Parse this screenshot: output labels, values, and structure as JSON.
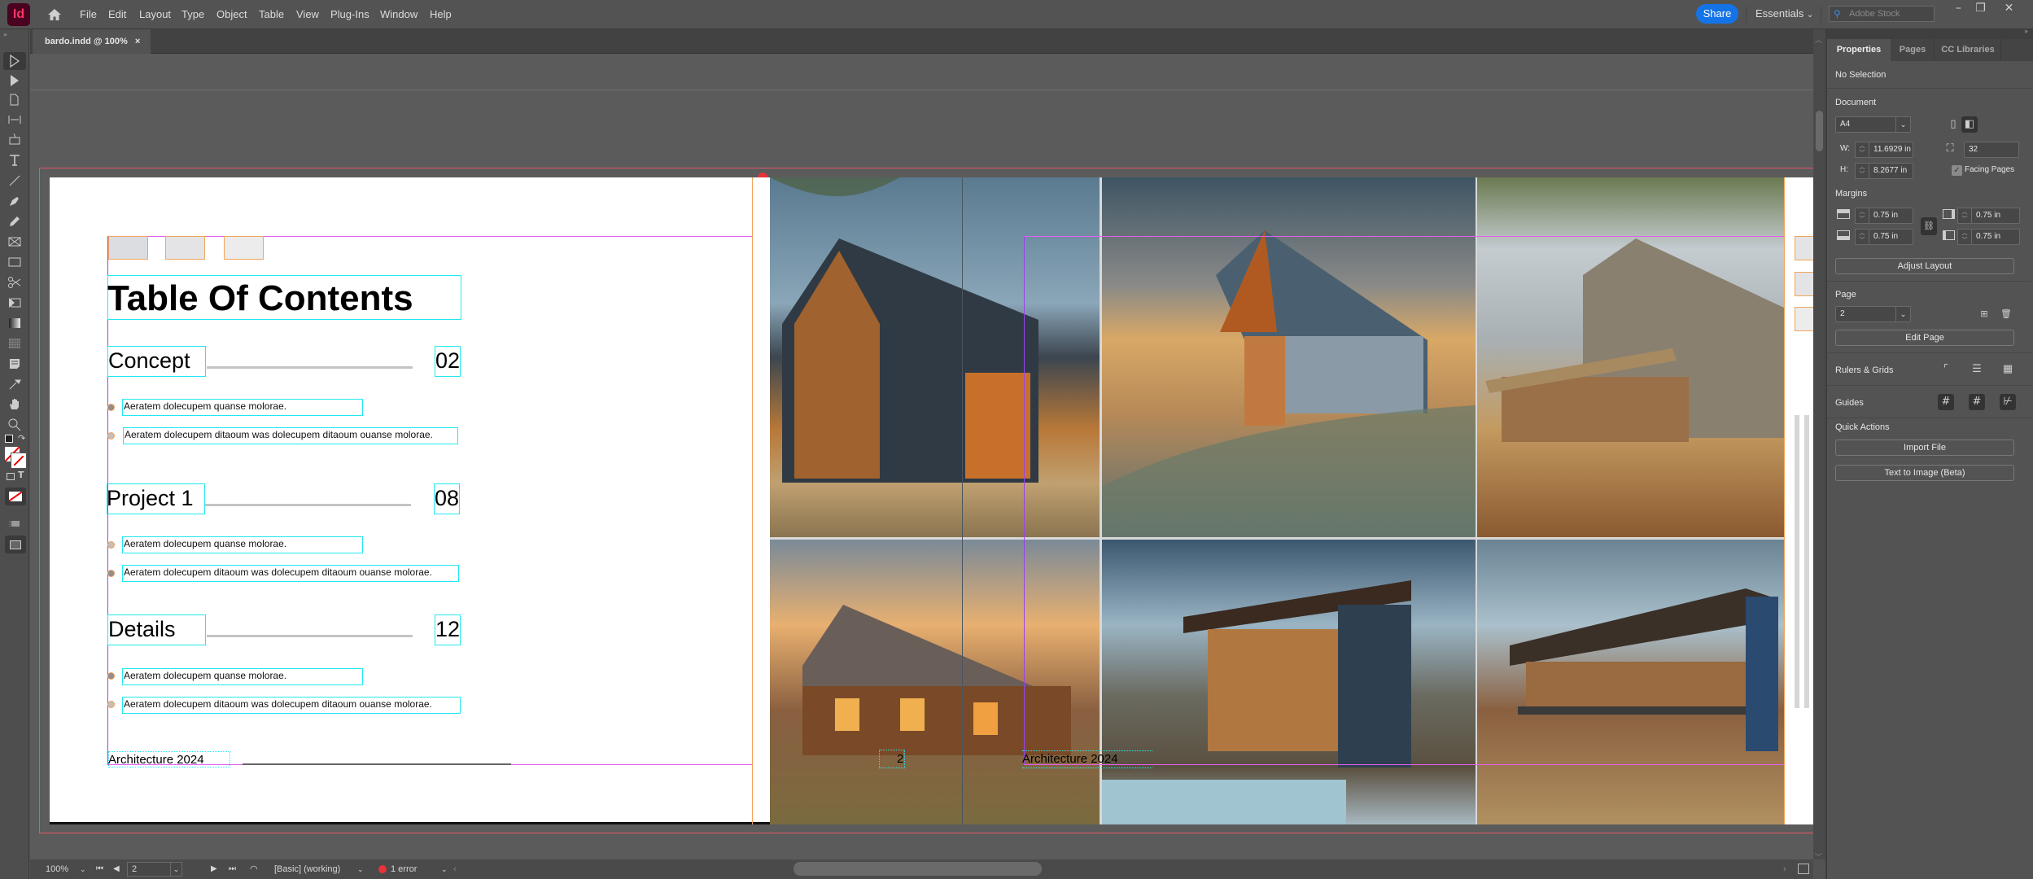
{
  "app": {
    "logo": "Id",
    "brand_color": "#ff3366"
  },
  "menu": [
    "File",
    "Edit",
    "Layout",
    "Type",
    "Object",
    "Table",
    "View",
    "Plug-Ins",
    "Window",
    "Help"
  ],
  "header": {
    "share_label": "Share",
    "workspace_label": "Essentials",
    "search_placeholder": "Adobe Stock",
    "share_color": "#1473e6"
  },
  "document_tab": {
    "label": "bardo.indd @ 100%",
    "close": "×"
  },
  "page": {
    "title": "Table Of Contents",
    "sections": [
      {
        "name": "Concept",
        "page": "02",
        "items": [
          "Aeratem dolecupem quanse molorae.",
          "Aeratem dolecupem ditaoum was dolecupem ditaoum ouanse molorae."
        ]
      },
      {
        "name": "Project 1",
        "page": "08",
        "items": [
          "Aeratem dolecupem quanse molorae.",
          "Aeratem dolecupem ditaoum was dolecupem ditaoum ouanse molorae."
        ]
      },
      {
        "name": "Details",
        "page": "12",
        "items": [
          "Aeratem dolecupem quanse molorae.",
          "Aeratem dolecupem ditaoum was dolecupem ditaoum ouanse molorae."
        ]
      }
    ],
    "footer_left": "Architecture 2024",
    "page_number_left": "2",
    "footer_right": "Architecture 2024",
    "photos": [
      "modern-glass-barn-house",
      "hillside-barn-house-stilts",
      "rustic-two-story-farmhouse",
      "lit-farmhouse-at-dusk",
      "modern-house-with-pool",
      "farmhouse-with-deck"
    ]
  },
  "properties": {
    "tabs": [
      "Properties",
      "Pages",
      "CC Libraries"
    ],
    "selection": "No Selection",
    "document_label": "Document",
    "preset": "A4",
    "width_label": "W:",
    "width": "11.6929 in",
    "height_label": "H:",
    "height": "8.2677 in",
    "pages_count": "32",
    "facing_pages_label": "Facing Pages",
    "facing_pages_checked": true,
    "margins_label": "Margins",
    "margin_top": "0.75 in",
    "margin_bottom": "0.75 in",
    "margin_inside": "0.75 in",
    "margin_outside": "0.75 in",
    "adjust_layout": "Adjust Layout",
    "page_label": "Page",
    "page_value": "2",
    "edit_page": "Edit Page",
    "rulers_grids": "Rulers & Grids",
    "guides": "Guides",
    "quick_actions": "Quick Actions",
    "import_file": "Import File",
    "text_to_image": "Text to Image (Beta)"
  },
  "status": {
    "zoom": "100%",
    "page": "2",
    "preflight_profile": "[Basic] (working)",
    "errors": "1 error",
    "error_color": "#e8333a"
  }
}
